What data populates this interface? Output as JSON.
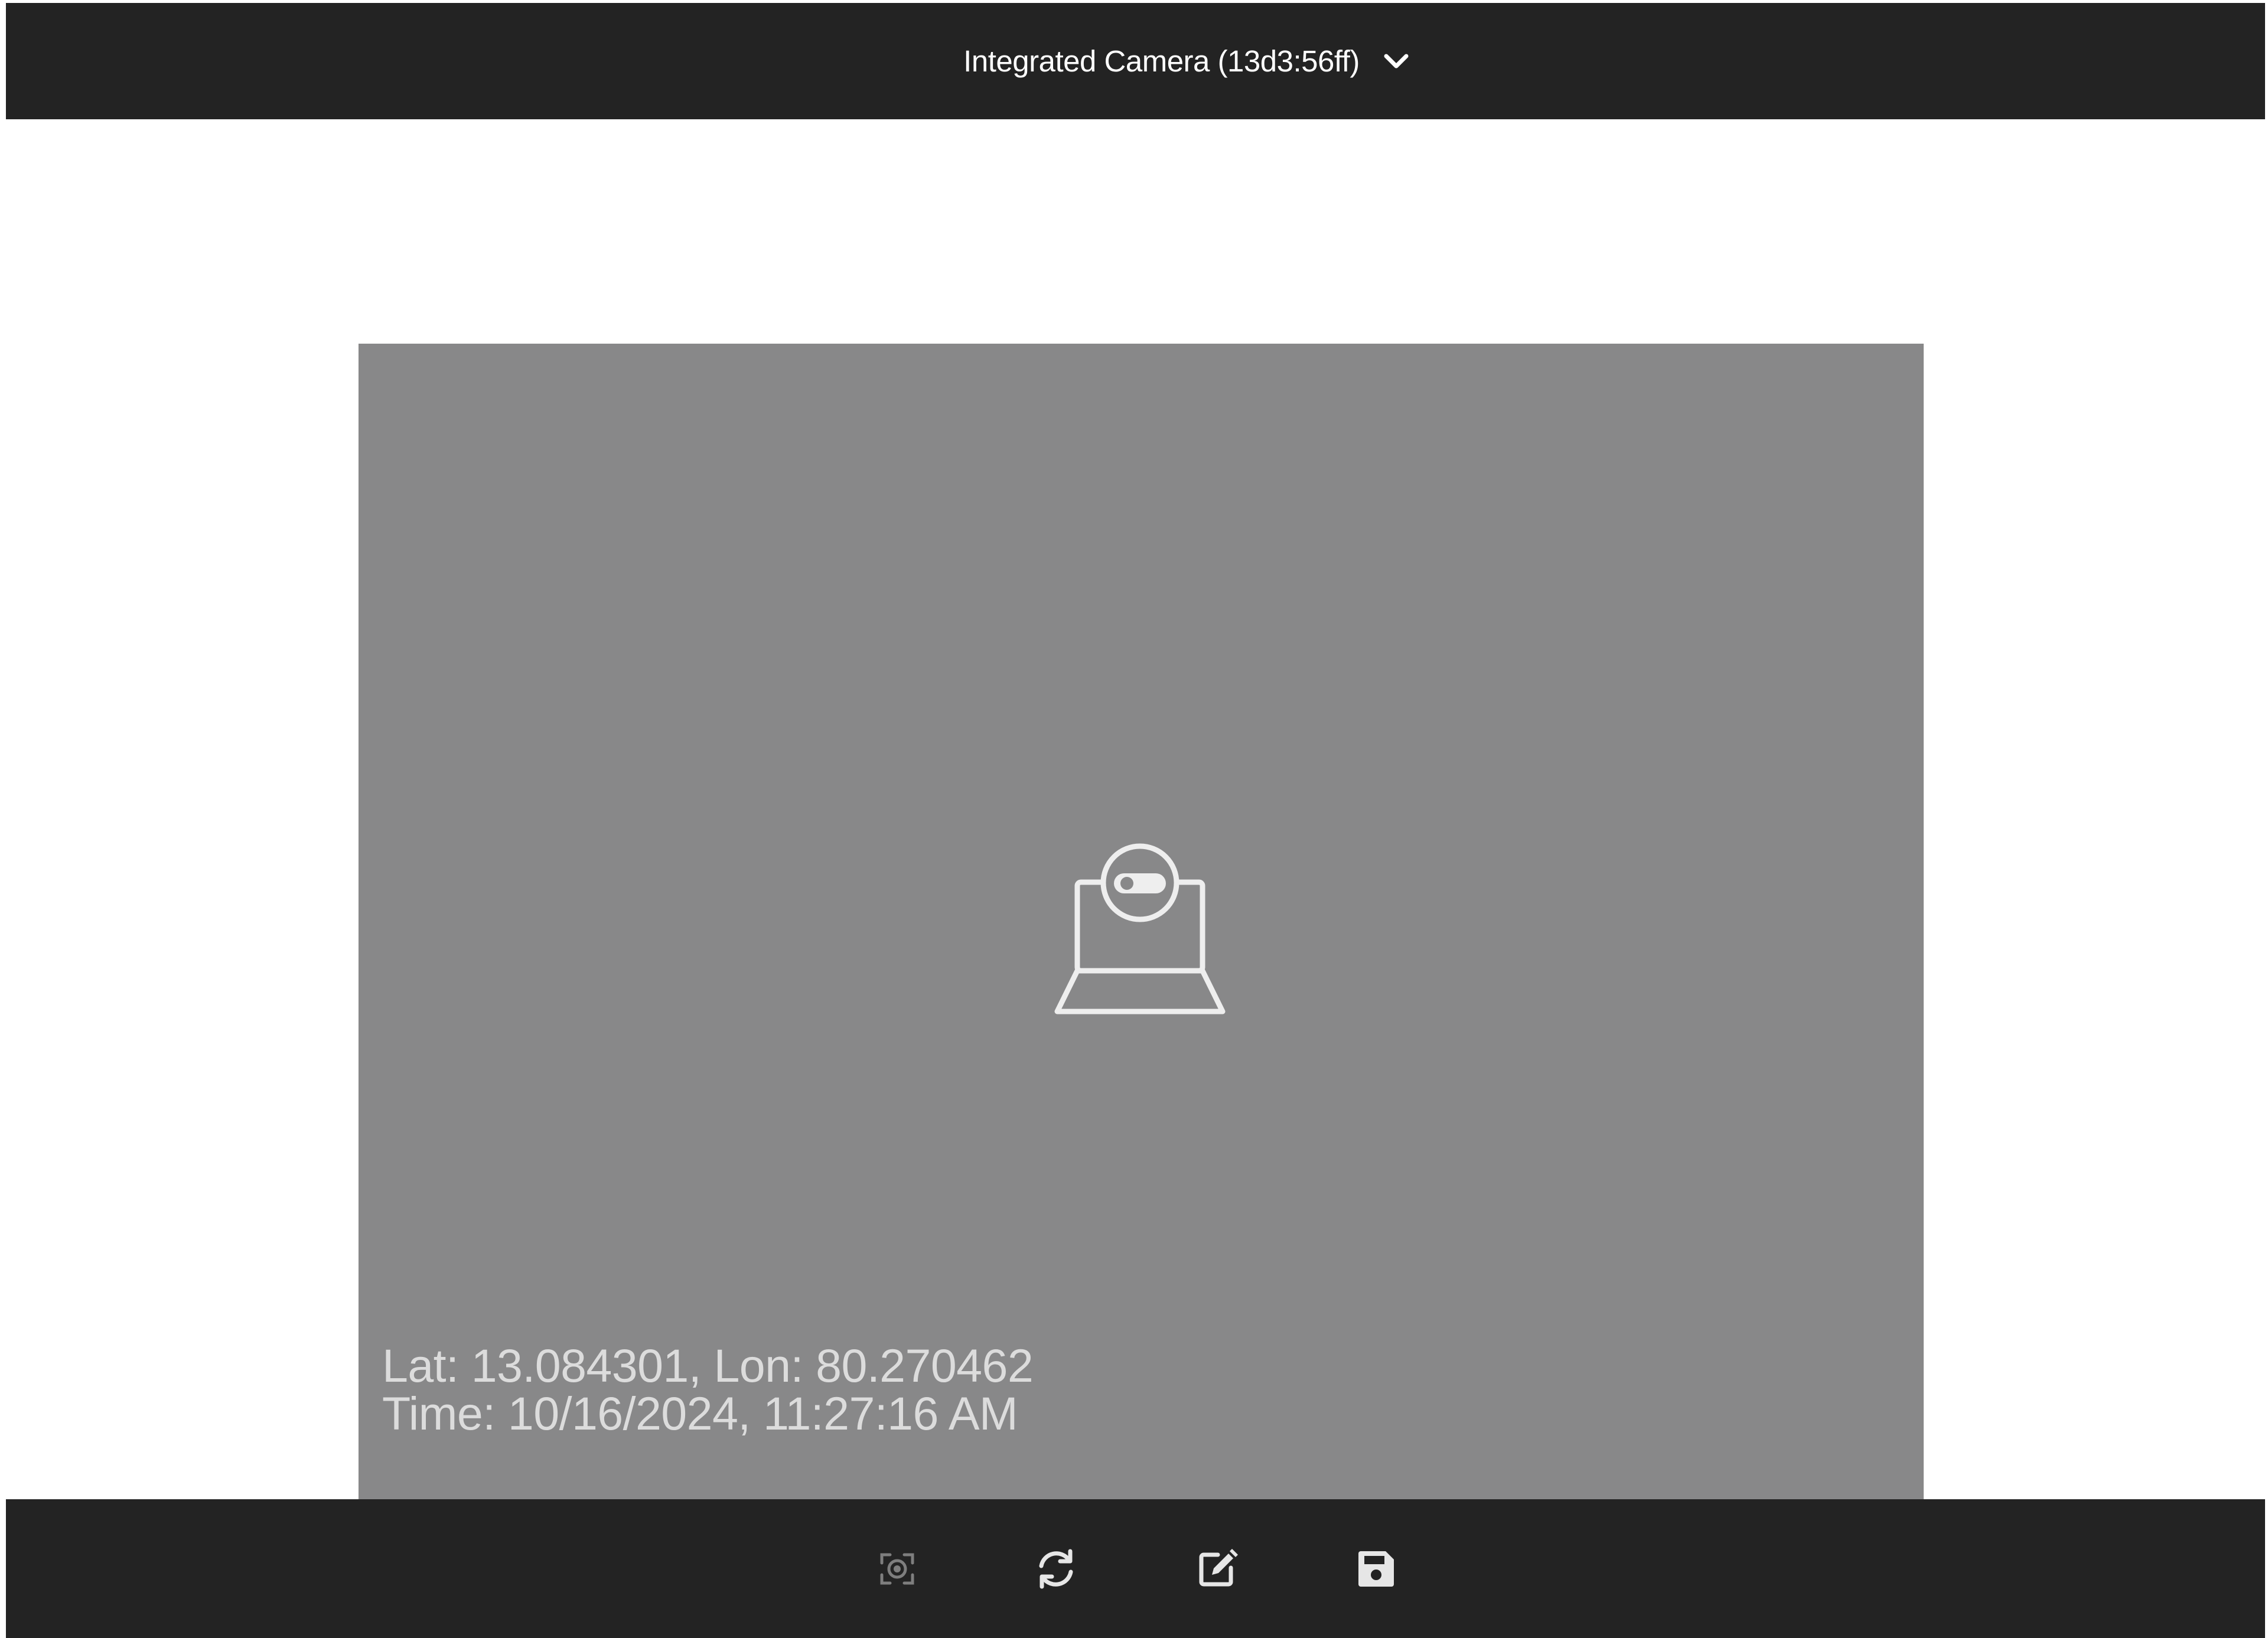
{
  "header": {
    "device_name": "Integrated Camera (13d3:56ff)"
  },
  "preview": {
    "location_text": "Lat: 13.084301, Lon: 80.270462",
    "time_text": "Time: 10/16/2024, 11:27:16 AM",
    "placeholder_icon": "camera-off-laptop-icon"
  },
  "toolbar": {
    "buttons": [
      {
        "name": "capture",
        "icon": "capture-icon",
        "enabled": false
      },
      {
        "name": "switch-camera",
        "icon": "refresh-icon",
        "enabled": true
      },
      {
        "name": "edit",
        "icon": "edit-icon",
        "enabled": true
      },
      {
        "name": "save",
        "icon": "save-icon",
        "enabled": true
      }
    ]
  },
  "colors": {
    "bar_background": "#232323",
    "preview_background": "#888889",
    "icon_color": "#e6e6e6",
    "overlay_text": "#dcdcdc"
  }
}
